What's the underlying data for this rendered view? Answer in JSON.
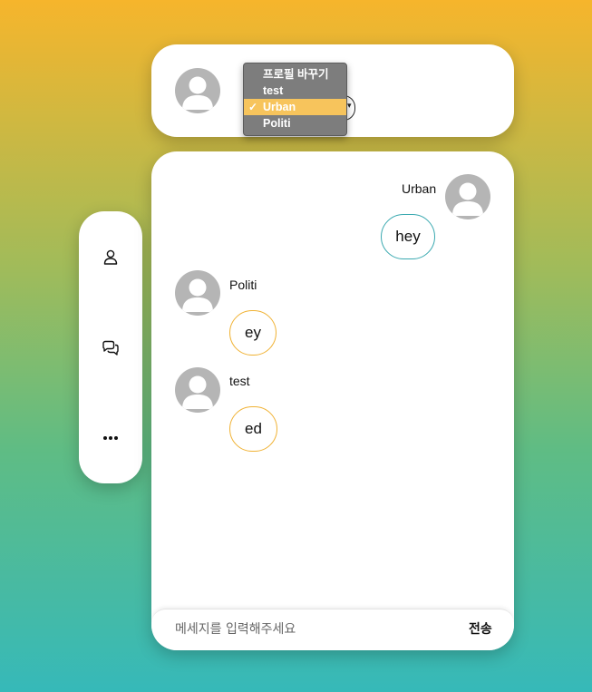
{
  "profile": {
    "avatar_icon": "user-avatar-icon",
    "dropdown": {
      "options": [
        {
          "label": "프로필 바꾸기",
          "selected": false
        },
        {
          "label": "test",
          "selected": false
        },
        {
          "label": "Urban",
          "selected": true
        },
        {
          "label": "Politi",
          "selected": false
        }
      ],
      "check_mark": "✓"
    }
  },
  "sidebar": {
    "items": [
      {
        "icon": "user-icon"
      },
      {
        "icon": "chat-bubbles-icon"
      },
      {
        "icon": "more-dots-icon"
      }
    ]
  },
  "chat": {
    "messages": [
      {
        "sender": "Urban",
        "text": "hey",
        "mine": true
      },
      {
        "sender": "Politi",
        "text": "ey",
        "mine": false
      },
      {
        "sender": "test",
        "text": "ed",
        "mine": false
      }
    ]
  },
  "composer": {
    "placeholder": "메세지를 입력해주세요",
    "value": "",
    "send_label": "전송"
  },
  "colors": {
    "gradient_top": "#f6b52c",
    "gradient_bottom": "#36b9b9",
    "mine_border": "#3aa9b0",
    "theirs_border": "#f0b234",
    "dropdown_bg": "#7d7d7d",
    "dropdown_selected": "#f7c45c",
    "avatar": "#b5b5b5"
  }
}
